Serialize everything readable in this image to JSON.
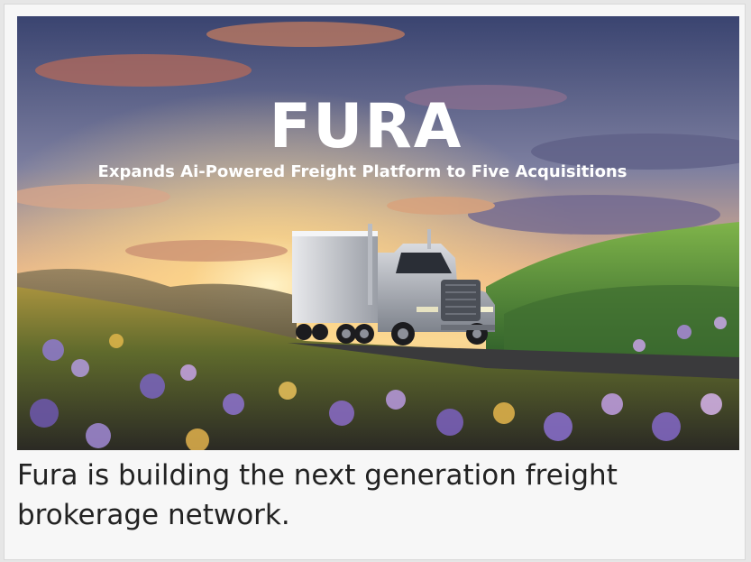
{
  "hero": {
    "logo": "FURA",
    "tagline": "Expands Ai-Powered Freight Platform to Five Acquisitions",
    "colors": {
      "sky_top": "#36406a",
      "sky_glow": "#f4c27a",
      "hills": "#4f8a3a",
      "flowers": "#8c6cc4",
      "truck": "#c9ccd2"
    }
  },
  "caption": {
    "text": "Fura is building the next generation freight brokerage network."
  }
}
